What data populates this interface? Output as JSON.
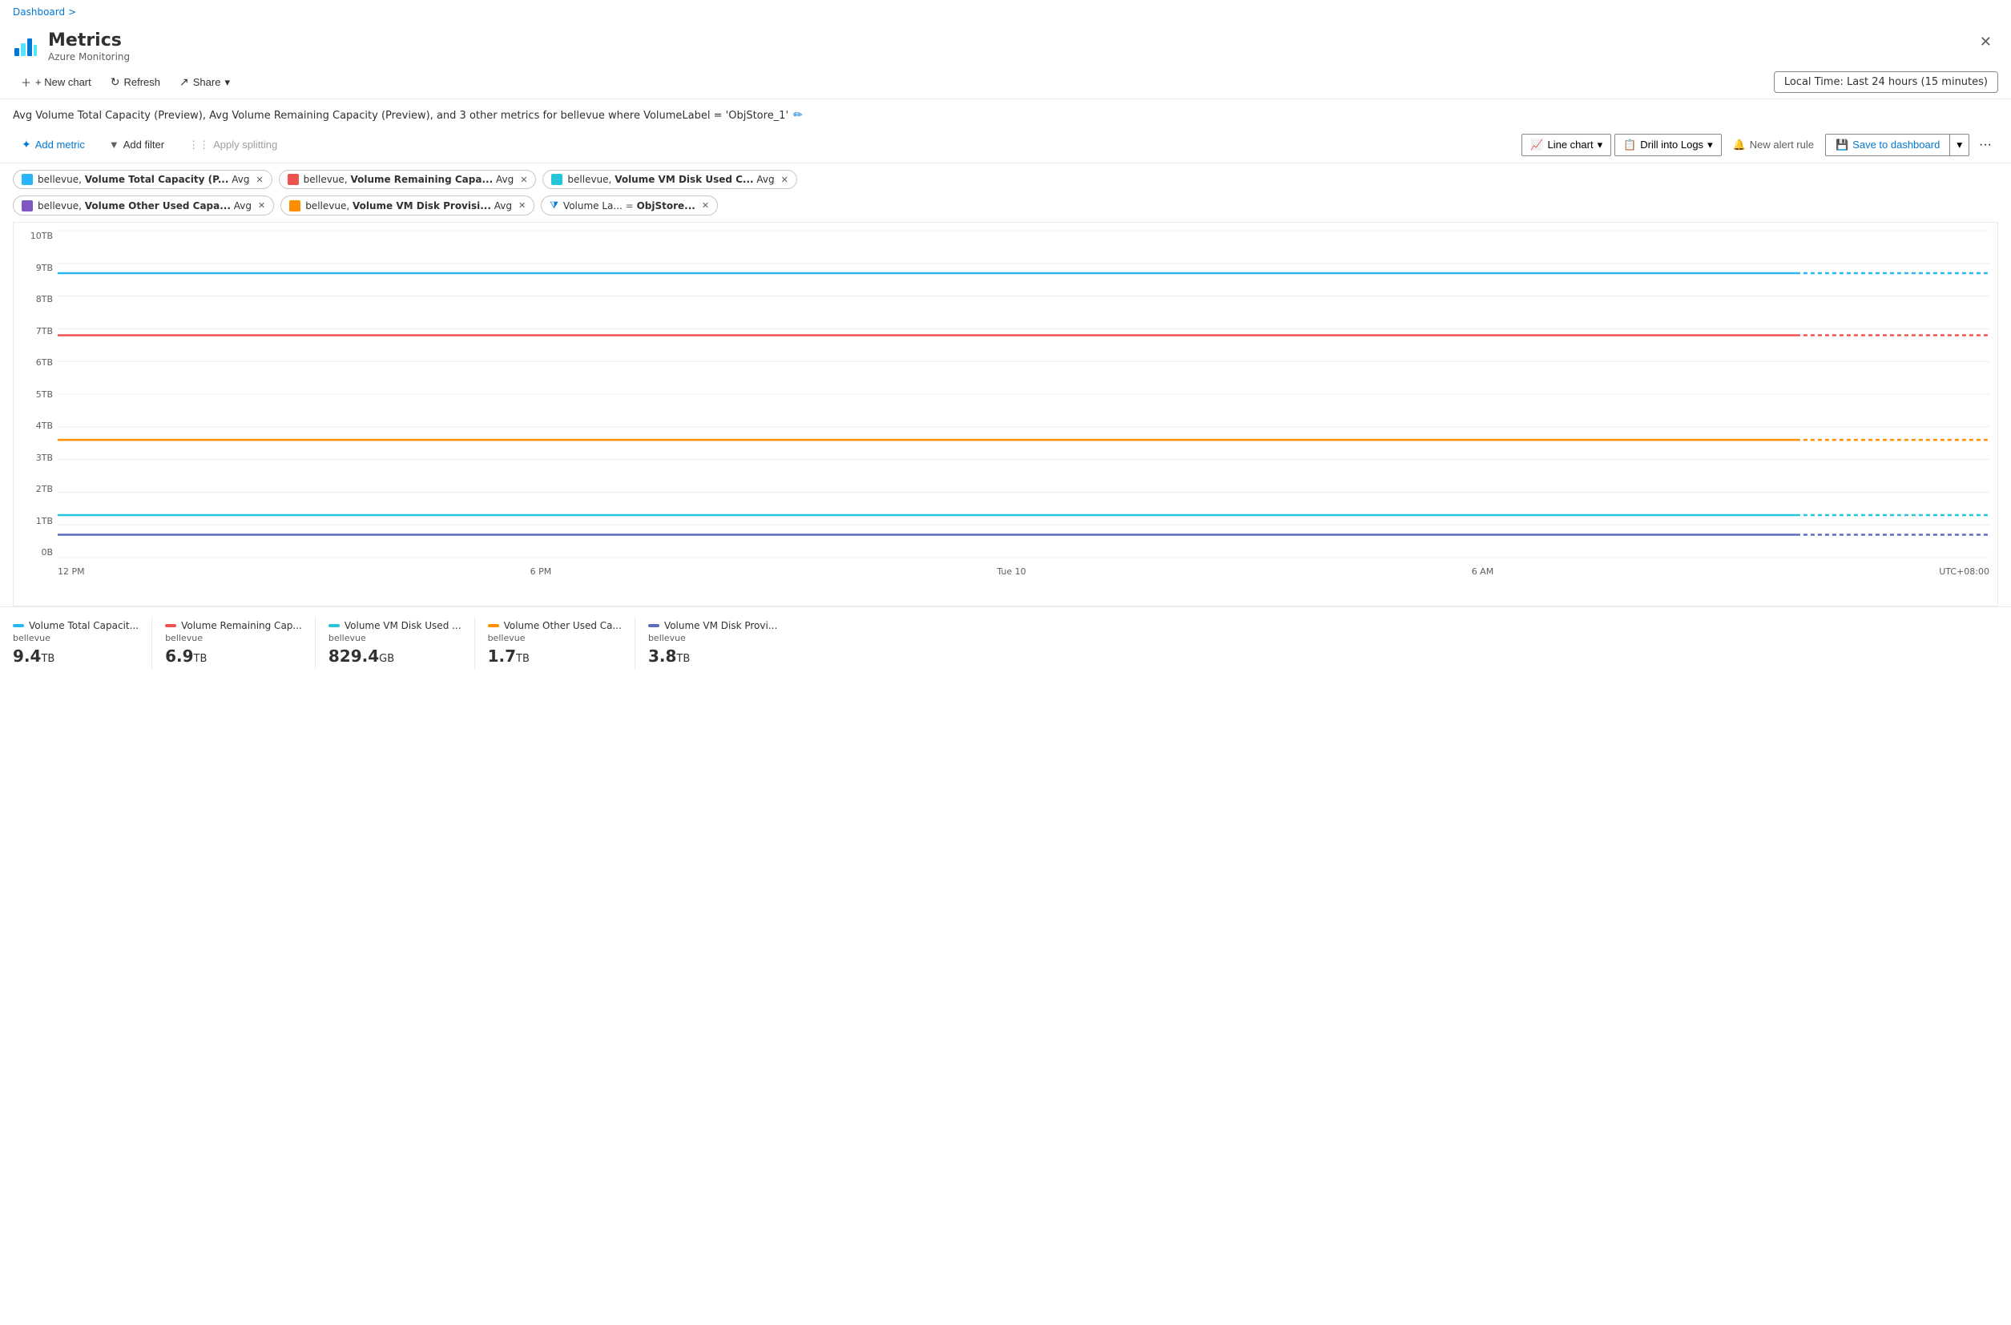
{
  "breadcrumb": {
    "text": "Dashboard",
    "sep": ">"
  },
  "header": {
    "title": "Metrics",
    "subtitle": "Azure Monitoring",
    "close_label": "✕"
  },
  "toolbar": {
    "new_chart": "+ New chart",
    "refresh": "Refresh",
    "share": "Share",
    "time_selector": "Local Time: Last 24 hours (15 minutes)"
  },
  "chart_title": "Avg Volume Total Capacity (Preview), Avg Volume Remaining Capacity (Preview), and 3 other metrics for bellevue where VolumeLabel = 'ObjStore_1'",
  "metrics_toolbar": {
    "add_metric": "Add metric",
    "add_filter": "Add filter",
    "apply_splitting": "Apply splitting",
    "line_chart": "Line chart",
    "drill_into_logs": "Drill into Logs",
    "new_alert_rule": "New alert rule",
    "save_to_dashboard": "Save to dashboard"
  },
  "tags": [
    {
      "id": 1,
      "color": "#29b6f6",
      "text": "bellevue,",
      "bold": "Volume Total Capacity (P...",
      "suffix": "Avg"
    },
    {
      "id": 2,
      "color": "#ef5350",
      "text": "bellevue,",
      "bold": "Volume Remaining Capa...",
      "suffix": "Avg"
    },
    {
      "id": 3,
      "color": "#26c6da",
      "text": "bellevue,",
      "bold": "Volume VM Disk Used C...",
      "suffix": "Avg"
    },
    {
      "id": 4,
      "color": "#7e57c2",
      "text": "bellevue,",
      "bold": "Volume Other Used Capa...",
      "suffix": "Avg"
    },
    {
      "id": 5,
      "color": "#ff8f00",
      "text": "bellevue,",
      "bold": "Volume VM Disk Provisi...",
      "suffix": "Avg"
    }
  ],
  "filter_tag": {
    "label": "Volume La...",
    "op": "=",
    "value": "ObjStore..."
  },
  "y_axis": {
    "labels": [
      "10TB",
      "9TB",
      "8TB",
      "7TB",
      "6TB",
      "5TB",
      "4TB",
      "3TB",
      "2TB",
      "1TB",
      "0B"
    ]
  },
  "x_axis": {
    "labels": [
      "12 PM",
      "6 PM",
      "Tue 10",
      "6 AM",
      "UTC+08:00"
    ]
  },
  "chart_lines": [
    {
      "id": "line1",
      "color": "#29b6f6",
      "y_pct": 87,
      "label": "Volume Total Capacity"
    },
    {
      "id": "line2",
      "color": "#ef5350",
      "y_pct": 68,
      "label": "Volume Remaining Cap"
    },
    {
      "id": "line3",
      "color": "#ff8f00",
      "y_pct": 36,
      "label": "Volume Other Used"
    },
    {
      "id": "line4",
      "color": "#26c6da",
      "y_pct": 13,
      "label": "Volume VM Disk Used"
    },
    {
      "id": "line5",
      "color": "#5c6bc0",
      "y_pct": 7,
      "label": "Volume VM Disk Provis"
    }
  ],
  "legend": [
    {
      "label": "Volume Total Capacit...",
      "sub": "bellevue",
      "color": "#29b6f6",
      "value": "9.4",
      "unit": "TB"
    },
    {
      "label": "Volume Remaining Cap...",
      "sub": "bellevue",
      "color": "#ef5350",
      "value": "6.9",
      "unit": "TB"
    },
    {
      "label": "Volume VM Disk Used ...",
      "sub": "bellevue",
      "color": "#26c6da",
      "value": "829.4",
      "unit": "GB"
    },
    {
      "label": "Volume Other Used Ca...",
      "sub": "bellevue",
      "color": "#ff8f00",
      "value": "1.7",
      "unit": "TB"
    },
    {
      "label": "Volume VM Disk Provi...",
      "sub": "bellevue",
      "color": "#5c6bc0",
      "value": "3.8",
      "unit": "TB"
    }
  ]
}
